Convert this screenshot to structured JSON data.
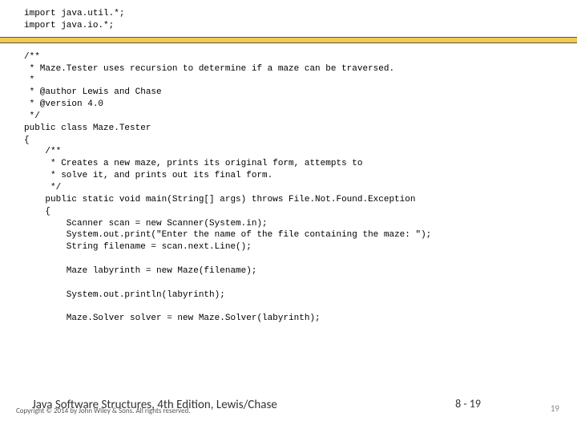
{
  "code_top": "import java.util.*;\nimport java.io.*;",
  "code_body": "/**\n * Maze.Tester uses recursion to determine if a maze can be traversed.\n *\n * @author Lewis and Chase\n * @version 4.0\n */\npublic class Maze.Tester\n{\n    /**\n     * Creates a new maze, prints its original form, attempts to\n     * solve it, and prints out its final form.\n     */\n    public static void main(String[] args) throws File.Not.Found.Exception\n    {\n        Scanner scan = new Scanner(System.in);\n        System.out.print(\"Enter the name of the file containing the maze: \");\n        String filename = scan.next.Line();\n\n        Maze labyrinth = new Maze(filename);\n\n        System.out.println(labyrinth);\n\n        Maze.Solver solver = new Maze.Solver(labyrinth);",
  "footer": {
    "book_title": "Java Software Structures, 4th Edition, Lewis/Chase",
    "copyright": "Copyright © 2014 by John Wiley & Sons. All rights reserved.",
    "page_num": "8 - 19",
    "slide_num": "19"
  }
}
